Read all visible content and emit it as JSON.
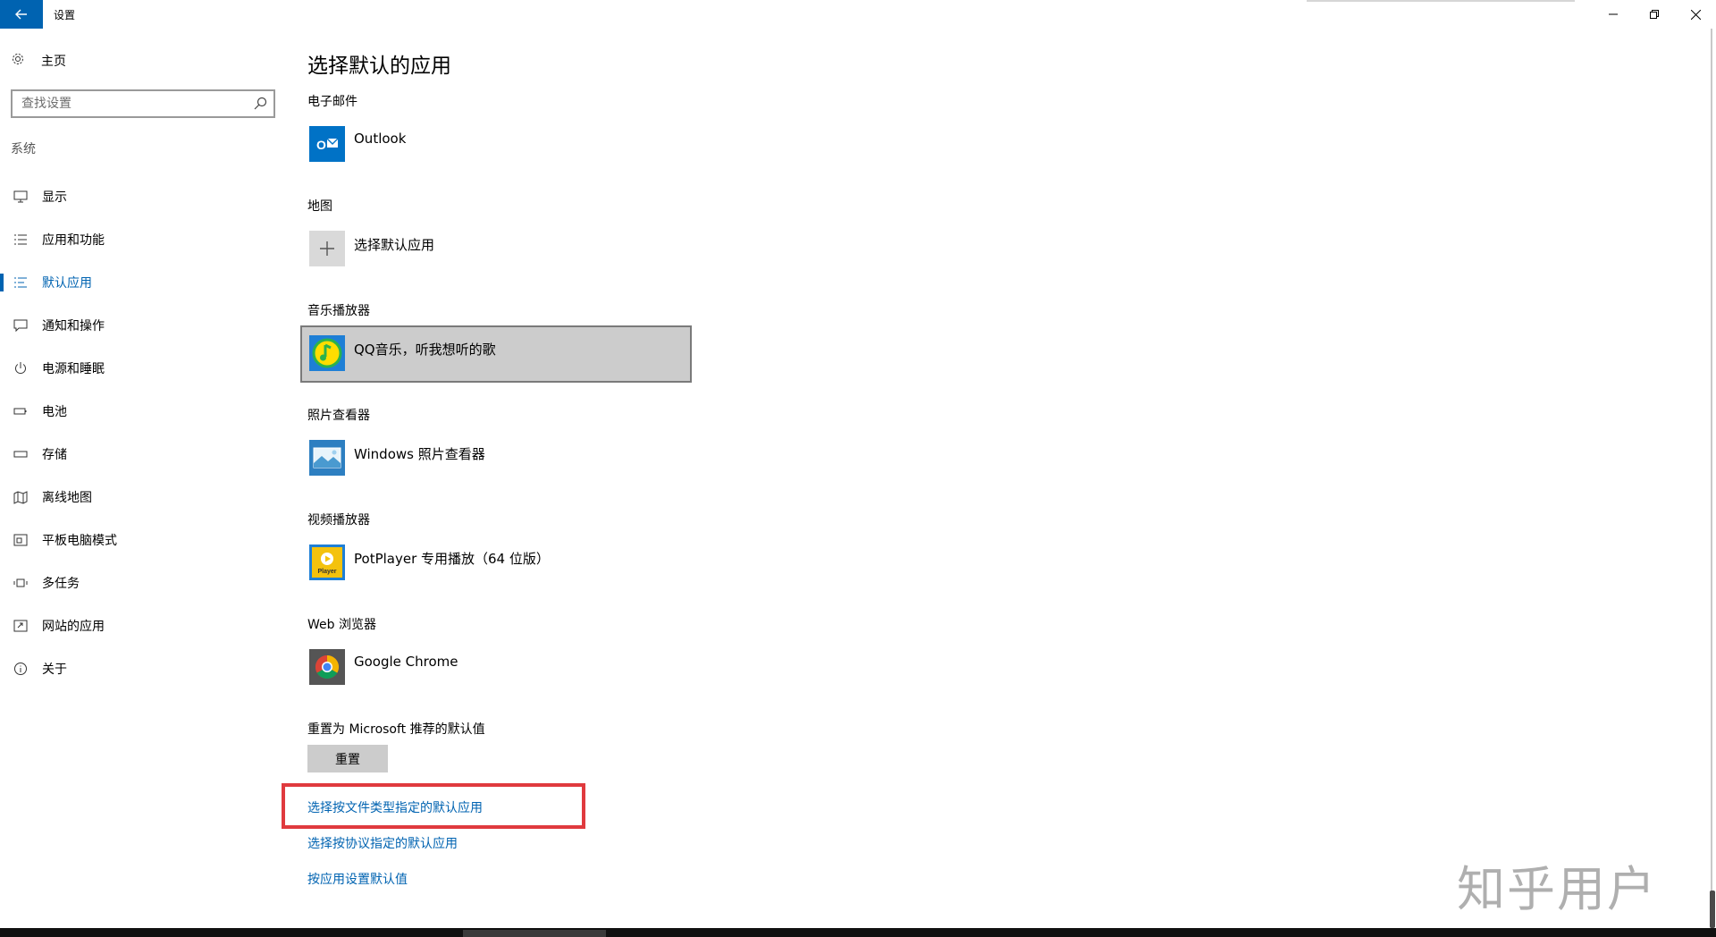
{
  "window": {
    "title": "设置",
    "back_icon": "arrow-left-icon",
    "accent_color": "#0063b1"
  },
  "sidebar": {
    "home_label": "主页",
    "search_placeholder": "查找设置",
    "section": "系统",
    "items": [
      {
        "label": "显示",
        "icon": "monitor-icon",
        "active": false
      },
      {
        "label": "应用和功能",
        "icon": "list-icon",
        "active": false
      },
      {
        "label": "默认应用",
        "icon": "default-apps-icon",
        "active": true
      },
      {
        "label": "通知和操作",
        "icon": "notification-icon",
        "active": false
      },
      {
        "label": "电源和睡眠",
        "icon": "power-icon",
        "active": false
      },
      {
        "label": "电池",
        "icon": "battery-icon",
        "active": false
      },
      {
        "label": "存储",
        "icon": "storage-icon",
        "active": false
      },
      {
        "label": "离线地图",
        "icon": "map-icon",
        "active": false
      },
      {
        "label": "平板电脑模式",
        "icon": "tablet-icon",
        "active": false
      },
      {
        "label": "多任务",
        "icon": "multitask-icon",
        "active": false
      },
      {
        "label": "网站的应用",
        "icon": "web-apps-icon",
        "active": false
      },
      {
        "label": "关于",
        "icon": "info-icon",
        "active": false
      }
    ]
  },
  "main": {
    "title": "选择默认的应用",
    "categories": [
      {
        "label": "电子邮件",
        "app": "Outlook",
        "icon": "outlook-icon"
      },
      {
        "label": "地图",
        "app": "选择默认应用",
        "icon": "plus-icon"
      },
      {
        "label": "音乐播放器",
        "app": "QQ音乐，听我想听的歌",
        "icon": "qq-music-icon"
      },
      {
        "label": "照片查看器",
        "app": "Windows 照片查看器",
        "icon": "photo-viewer-icon"
      },
      {
        "label": "视频播放器",
        "app": "PotPlayer 专用播放（64 位版）",
        "icon": "potplayer-icon",
        "icon_text": "Player"
      },
      {
        "label": "Web 浏览器",
        "app": "Google Chrome",
        "icon": "chrome-icon"
      }
    ],
    "reset_label": "重置为 Microsoft 推荐的默认值",
    "reset_button": "重置",
    "links": [
      "选择按文件类型指定的默认应用",
      "选择按协议指定的默认应用",
      "按应用设置默认值"
    ],
    "highlight_color": "#e03a3e"
  },
  "watermark": "知乎用户"
}
